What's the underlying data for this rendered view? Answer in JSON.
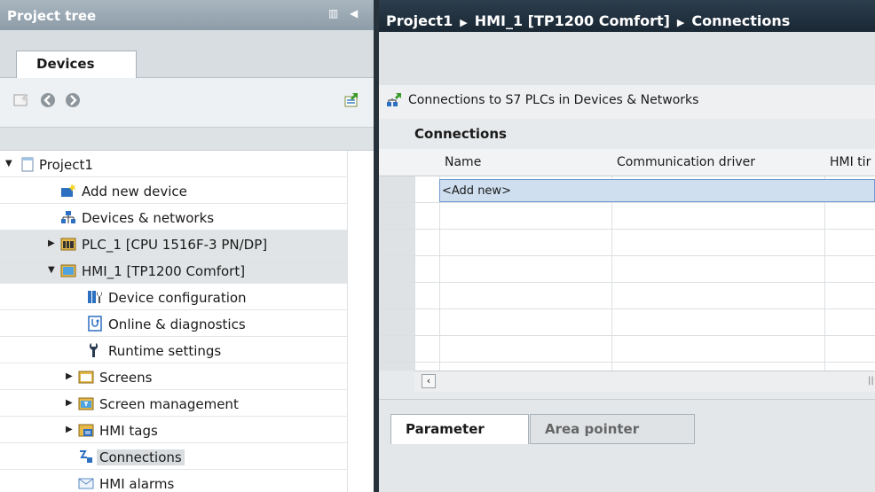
{
  "project_tree": {
    "title": "Project tree",
    "tab_label": "Devices",
    "items": [
      {
        "label": "Project1",
        "icon": "project-icon",
        "expander": "expanded"
      },
      {
        "label": "Add new device",
        "icon": "add-device-icon",
        "expander": "none"
      },
      {
        "label": "Devices & networks",
        "icon": "network-icon",
        "expander": "none"
      },
      {
        "label": "PLC_1 [CPU 1516F-3 PN/DP]",
        "icon": "plc-icon",
        "expander": "collapsed"
      },
      {
        "label": "HMI_1 [TP1200 Comfort]",
        "icon": "hmi-icon",
        "expander": "expanded"
      },
      {
        "label": "Device configuration",
        "icon": "device-config-icon",
        "expander": "none"
      },
      {
        "label": "Online & diagnostics",
        "icon": "diagnostics-icon",
        "expander": "none"
      },
      {
        "label": "Runtime settings",
        "icon": "wrench-icon",
        "expander": "none"
      },
      {
        "label": "Screens",
        "icon": "folder-icon",
        "expander": "collapsed"
      },
      {
        "label": "Screen management",
        "icon": "screen-management-icon",
        "expander": "collapsed"
      },
      {
        "label": "HMI tags",
        "icon": "tags-icon",
        "expander": "collapsed"
      },
      {
        "label": "Connections",
        "icon": "connections-icon",
        "expander": "none"
      },
      {
        "label": "HMI alarms",
        "icon": "alarms-icon",
        "expander": "none"
      }
    ]
  },
  "breadcrumb": {
    "items": [
      "Project1",
      "HMI_1 [TP1200 Comfort]",
      "Connections"
    ]
  },
  "editor": {
    "toolbar_text": "Connections to S7 PLCs in Devices & Networks",
    "section_title": "Connections",
    "columns": [
      "Name",
      "Communication driver",
      "HMI tir"
    ],
    "add_new": "<Add new>",
    "bottom_tabs": [
      "Parameter",
      "Area pointer"
    ]
  },
  "colors": {
    "title_bar": "#8d9ca8",
    "breadcrumb_bar": "#1a2834",
    "selection_row": "#cfdff0",
    "selection_border": "#6f9bd0"
  }
}
